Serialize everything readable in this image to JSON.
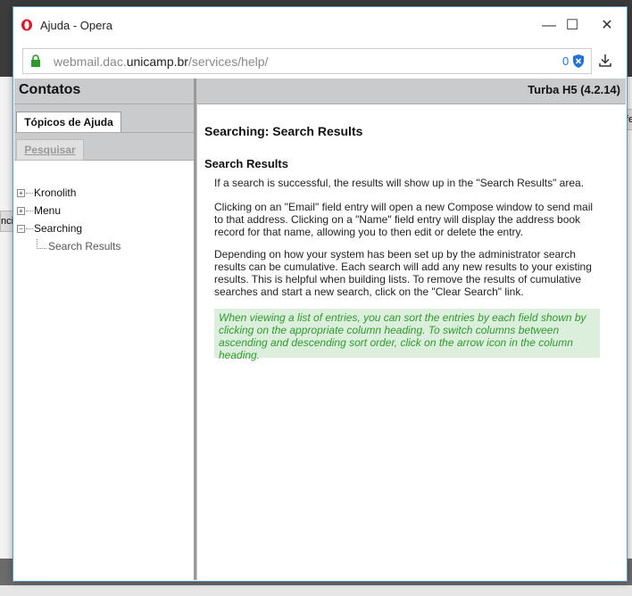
{
  "window": {
    "title": "Ajuda - Opera",
    "minimize_symbol": "—",
    "maximize_symbol": "☐",
    "close_symbol": "✕"
  },
  "addressbar": {
    "url_prefix": "webmail.dac.",
    "url_host": "unicamp.br",
    "url_path": "/services/help/",
    "blocked_count": "0"
  },
  "sidebar": {
    "title": "Contatos",
    "tab_label": "Tópicos de Ajuda",
    "search_label": "Pesquisar",
    "tree": {
      "item1": "Kronolith",
      "item2": "Menu",
      "item3": "Searching",
      "item3_child": "Search Results"
    }
  },
  "main": {
    "version": "Turba H5 (4.2.14)",
    "page_title": "Searching: Search Results",
    "section_title": "Search Results",
    "para1": "If a search is successful, the results will show up in the \"Search Results\" area.",
    "para2": "Clicking on an \"Email\" field entry will open a new Compose window to send mail to that address. Clicking on a \"Name\" field entry will display the address book record for that name, allowing you to then edit or delete the entry.",
    "para3": "Depending on how your system has been set up by the administrator search results can be cumulative. Each search will add any new results to your existing results. This is helpful when building lists. To remove the results of cumulative searches and start a new search, click on the \"Clear Search\" link.",
    "tip": "When viewing a list of entries, you can sort the entries by each field shown by clicking on the appropriate column heading. To switch columns between ascending and descending sort order, click on the arrow icon in the column heading."
  },
  "background": {
    "left_fragment": "nci",
    "right_fragment": "fe"
  }
}
